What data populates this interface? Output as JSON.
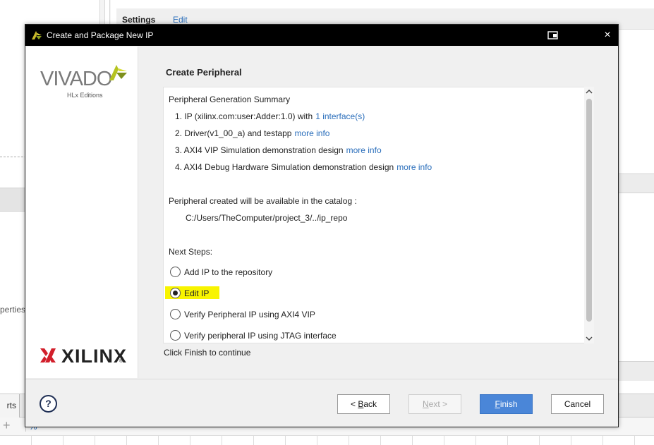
{
  "background": {
    "settings_tab": "Settings",
    "edit_link": "Edit",
    "left_fragment": "perties",
    "bottom_tab_fragment": "rts",
    "toolbar_add_glyph": "+",
    "toolbar_pct_glyph": "%"
  },
  "dialog": {
    "title": "Create and Package New IP",
    "brand": {
      "vivado_word": "VIVADO",
      "vivado_sub": "HLx Editions",
      "xilinx_word": "XILINX",
      "xilinx_reg": "®"
    },
    "heading": "Create Peripheral",
    "summary": {
      "title": "Peripheral Generation Summary",
      "items": [
        {
          "text": "1. IP (xilinx.com:user:Adder:1.0) with",
          "link": "1 interface(s)"
        },
        {
          "text": "2. Driver(v1_00_a) and testapp",
          "link": "more info"
        },
        {
          "text": "3. AXI4 VIP Simulation demonstration design",
          "link": "more info"
        },
        {
          "text": "4. AXI4 Debug Hardware Simulation demonstration design",
          "link": "more info"
        }
      ]
    },
    "catalog": {
      "label": "Peripheral created will be available in the catalog :",
      "path": "C:/Users/TheComputer/project_3/../ip_repo"
    },
    "next_steps": {
      "label": "Next Steps:",
      "options": [
        {
          "label": "Add IP to the repository",
          "selected": false
        },
        {
          "label": "Edit IP",
          "selected": true
        },
        {
          "label": "Verify Peripheral IP using AXI4 VIP",
          "selected": false
        },
        {
          "label": "Verify peripheral IP using JTAG interface",
          "selected": false
        }
      ]
    },
    "hint": "Click Finish to continue",
    "buttons": {
      "help": "?",
      "back_prefix": "< ",
      "back_accel": "B",
      "back_rest": "ack",
      "next_accel": "N",
      "next_rest": "ext >",
      "finish_accel": "F",
      "finish_rest": "inish",
      "cancel": "Cancel"
    },
    "colors": {
      "titlebar": "#000000",
      "link": "#2a6ebb",
      "highlight": "#f8f400",
      "primary_button": "#4a86d8",
      "vivado_leaf": "#b5c31f"
    },
    "icons": {
      "close": "×"
    }
  }
}
